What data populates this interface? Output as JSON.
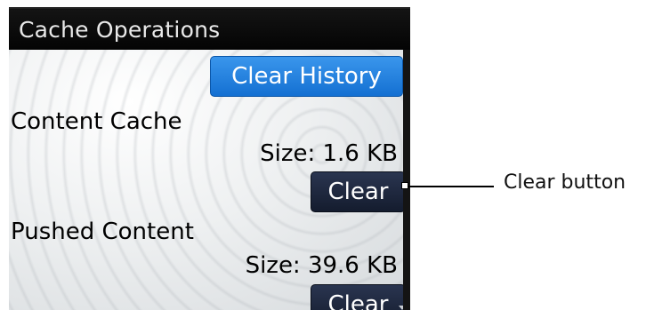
{
  "screen": {
    "title": "Cache Operations",
    "clear_history_label": "Clear History",
    "sections": [
      {
        "heading": "Content Cache",
        "size_text": "Size: 1.6 KB",
        "button_label": "Clear"
      },
      {
        "heading": "Pushed Content",
        "size_text": "Size: 39.6 KB",
        "button_label": "Clear"
      }
    ]
  },
  "annotation": {
    "callout_text": "Clear button"
  },
  "colors": {
    "header_bg": "#0a0a0a",
    "primary_button": "#1f7fe0",
    "secondary_button": "#1c2538"
  },
  "icons": {
    "scroll_indicator": "chevron-down-icon"
  }
}
